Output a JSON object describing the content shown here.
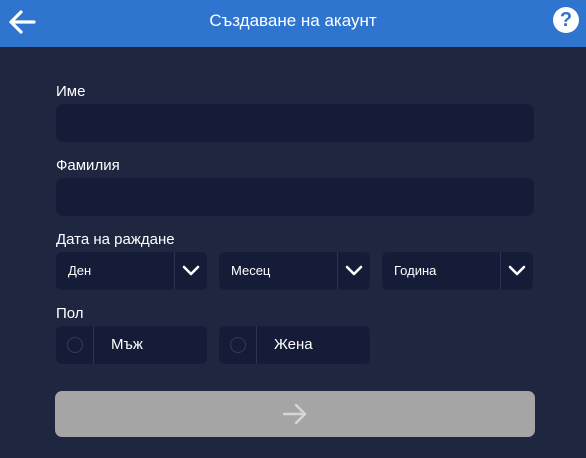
{
  "header": {
    "title": "Създаване на акаунт",
    "back_icon": "arrow-left-icon",
    "help_icon": "question-circle-icon",
    "help_glyph": "?",
    "bg_color": "#2f74cf"
  },
  "form": {
    "first_name": {
      "label": "Име",
      "value": "",
      "placeholder": ""
    },
    "last_name": {
      "label": "Фамилия",
      "value": "",
      "placeholder": ""
    },
    "birth_date": {
      "label": "Дата на раждане",
      "day": "Ден",
      "month": "Месец",
      "year": "Година"
    },
    "gender": {
      "label": "Пол",
      "male": "Мъж",
      "female": "Жена"
    },
    "submit_icon": "arrow-right-icon"
  },
  "colors": {
    "background": "#1e2640",
    "field": "#151c38",
    "submit_disabled": "#a5a5a5"
  }
}
